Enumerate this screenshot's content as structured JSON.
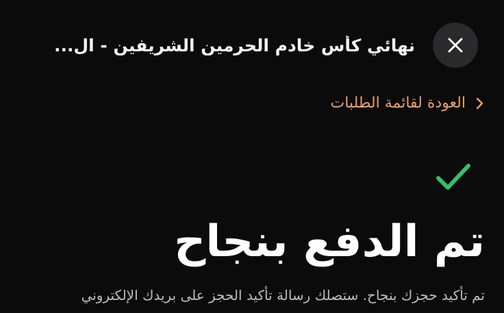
{
  "header": {
    "title": "نهائي كأس خادم الحرمين الشريفين - ال...",
    "close_icon": "close-icon"
  },
  "navigation": {
    "back_label": "العودة لقائمة الطلبات",
    "back_icon": "chevron-right-icon"
  },
  "confirmation": {
    "status_icon": "checkmark-icon",
    "title": "تم الدفع بنجاح",
    "message": "تم تأكيد حجزك بنجاح. ستصلك رسالة تأكيد الحجز على بريدك الإلكتروني"
  },
  "colors": {
    "background": "#0b0b0c",
    "accent_link": "#e9a06a",
    "success": "#2fc26b",
    "close_button_bg": "#2a2a2d"
  }
}
